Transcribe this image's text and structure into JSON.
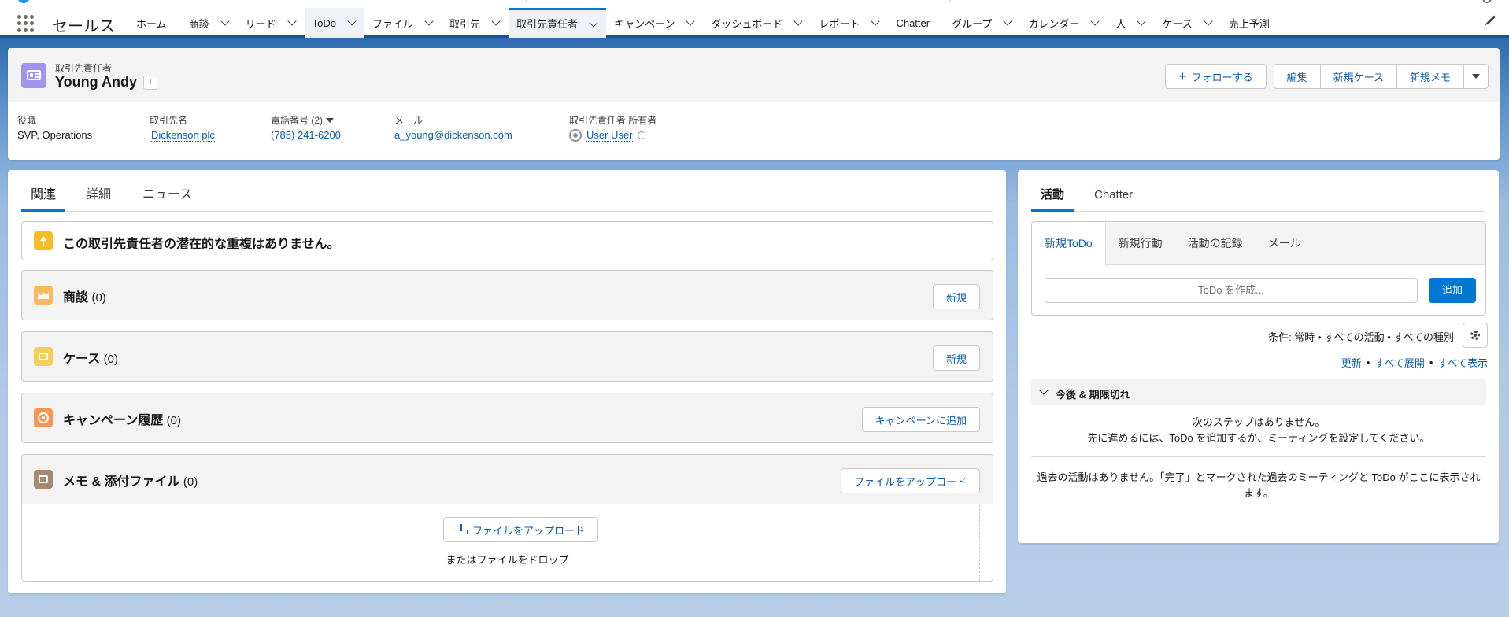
{
  "app": {
    "name": "セールス"
  },
  "nav": {
    "tabs": [
      {
        "label": "ホーム",
        "chevron": false
      },
      {
        "label": "商談",
        "chevron": true
      },
      {
        "label": "リード",
        "chevron": true
      },
      {
        "label": "ToDo",
        "chevron": true
      },
      {
        "label": "ファイル",
        "chevron": true
      },
      {
        "label": "取引先",
        "chevron": true
      },
      {
        "label": "取引先責任者",
        "chevron": true
      },
      {
        "label": "キャンペーン",
        "chevron": true
      },
      {
        "label": "ダッシュボード",
        "chevron": true
      },
      {
        "label": "レポート",
        "chevron": true
      },
      {
        "label": "Chatter",
        "chevron": false
      },
      {
        "label": "グループ",
        "chevron": true
      },
      {
        "label": "カレンダー",
        "chevron": true
      },
      {
        "label": "人",
        "chevron": true
      },
      {
        "label": "ケース",
        "chevron": true
      },
      {
        "label": "売上予測",
        "chevron": false
      }
    ],
    "active_tab": "取引先責任者"
  },
  "record": {
    "type_label": "取引先責任者",
    "name": "Young Andy",
    "actions": {
      "follow": "フォローする",
      "edit": "編集",
      "new_case": "新規ケース",
      "new_note": "新規メモ"
    },
    "fields": {
      "title_label": "役職",
      "title_value": "SVP, Operations",
      "account_label": "取引先名",
      "account_value": "Dickenson plc",
      "phone_label": "電話番号 (2)",
      "phone_value": "(785) 241-6200",
      "email_label": "メール",
      "email_value": "a_young@dickenson.com",
      "owner_label": "取引先責任者 所有者",
      "owner_value": "User User"
    }
  },
  "main": {
    "tabs": {
      "related": "関連",
      "details": "詳細",
      "news": "ニュース"
    },
    "duplicates_message": "この取引先責任者の潜在的な重複はありません。",
    "related_lists": {
      "opportunities": {
        "title": "商談",
        "count": "(0)",
        "button": "新規"
      },
      "cases": {
        "title": "ケース",
        "count": "(0)",
        "button": "新規"
      },
      "campaign_history": {
        "title": "キャンペーン履歴",
        "count": "(0)",
        "button": "キャンペーンに追加"
      },
      "notes": {
        "title": "メモ & 添付ファイル",
        "count": "(0)",
        "button": "ファイルをアップロード"
      }
    },
    "upload": {
      "button": "ファイルをアップロード",
      "drop_text": "またはファイルをドロップ"
    }
  },
  "activity": {
    "tabs": {
      "activity": "活動",
      "chatter": "Chatter"
    },
    "composer_tabs": {
      "new_todo": "新規ToDo",
      "new_event": "新規行動",
      "log_call": "活動の記録",
      "email": "メール"
    },
    "todo_placeholder": "ToDo を作成...",
    "add_button": "追加",
    "filter_text": "条件: 常時 • すべての活動 • すべての種別",
    "links": {
      "refresh": "更新",
      "expand_all": "すべて展開",
      "view_all": "すべて表示"
    },
    "upcoming_title": "今後 & 期限切れ",
    "no_next_steps_line1": "次のステップはありません。",
    "no_next_steps_line2": "先に進めるには、ToDo を追加するか、ミーティングを設定してください。",
    "no_past_activity": "過去の活動はありません。「完了」とマークされた過去のミーティングと ToDo がここに表示されます。"
  },
  "colors": {
    "brand_blue": "#0176d3",
    "link_blue": "#0b5cab",
    "contact_icon": "#a094ed"
  }
}
